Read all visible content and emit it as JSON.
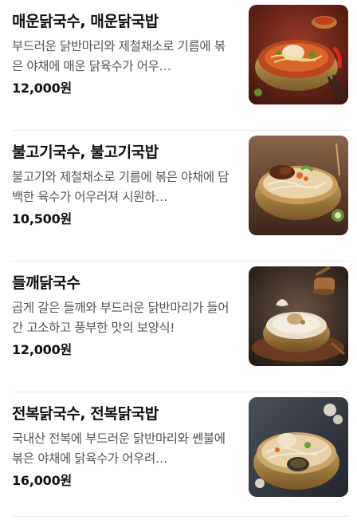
{
  "menu": {
    "items": [
      {
        "name": "매운닭국수, 매운닭국밥",
        "description": "부드러운 닭반마리와 제철채소로 기름에 볶은 야채에 매운 닭육수가 어우…",
        "price": "12,000원",
        "image": "spicy-chicken-noodle-photo",
        "image_tone": "#8a2f1e"
      },
      {
        "name": "불고기국수, 불고기국밥",
        "description": "불고기와 제철채소로 기름에 볶은 야채에 담백한 육수가 어우러져 시원하…",
        "price": "10,500원",
        "image": "bulgogi-noodle-photo",
        "image_tone": "#6b4a33"
      },
      {
        "name": "들깨닭국수",
        "description": "곱게 갈은 들깨와 부드러운 닭반마리가 들어간 고소하고 풍부한 맛의 보양식!",
        "price": "12,000원",
        "image": "perilla-chicken-noodle-photo",
        "image_tone": "#3b2a22"
      },
      {
        "name": "전복닭국수, 전복닭국밥",
        "description": "국내산 전복에 부드러운 닭반마리와 쎈불에 볶은 야채에 닭육수가 어우려…",
        "price": "16,000원",
        "image": "abalone-chicken-noodle-photo",
        "image_tone": "#3a3f4a"
      }
    ]
  }
}
